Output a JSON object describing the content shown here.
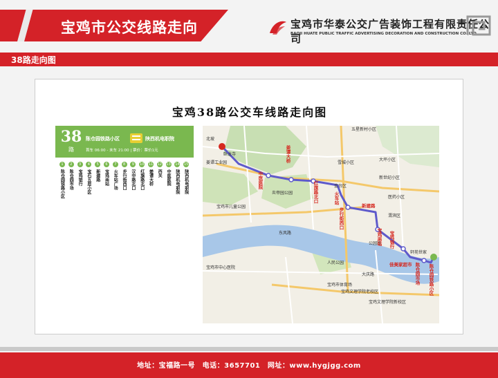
{
  "header": {
    "title": "宝鸡市公交线路走向",
    "company_cn": "宝鸡市华泰公交广告装饰工程有限责任公司",
    "company_en": "BAOJI HUATE PUBLIC TRAFFIC ADVERTISING DECORATION AND CONSTRUCTION CO.,LTD"
  },
  "section": {
    "title": "38路走向图"
  },
  "card": {
    "title": "宝鸡38路公交车线路走向图"
  },
  "route": {
    "number": "38",
    "unit": "路",
    "from": "陈仓园铁路小区",
    "to": "陕西机电职院",
    "hours": "首车 06:00 - 末车 21:00",
    "fare": "票价：票价1元",
    "stops": [
      {
        "no": "1",
        "name": "陈仓园铁路小区"
      },
      {
        "no": "2",
        "name": "陈仓园市场"
      },
      {
        "no": "3",
        "name": "宝鸡银行"
      },
      {
        "no": "4",
        "name": "宝石五层小区"
      },
      {
        "no": "5",
        "name": "新建路"
      },
      {
        "no": "6",
        "name": "宝鸡南站"
      },
      {
        "no": "7",
        "name": "火车站广场"
      },
      {
        "no": "8",
        "name": "步行街西口"
      },
      {
        "no": "9",
        "name": "汉中路北口"
      },
      {
        "no": "10",
        "name": "红旗路北口"
      },
      {
        "no": "11",
        "name": "姜谭大桥"
      },
      {
        "no": "12",
        "name": "西关"
      },
      {
        "no": "13",
        "name": "中医医院"
      },
      {
        "no": "14",
        "name": "陕西机电职院"
      },
      {
        "no": "15",
        "name": "陕西机电职院"
      }
    ]
  },
  "map": {
    "labels": [
      "五星新村小区",
      "卧龙寺",
      "北坡",
      "姜谭工业园",
      "雪城小区",
      "金台区",
      "大坪小区",
      "新世纪小区",
      "医药小区",
      "渭滨区",
      "宝鸡市儿童公园",
      "炎帝园公园",
      "人民公园",
      "宝鸡市体育场",
      "宝鸡文理学院老校区",
      "宝鸡市中心医院",
      "东风路",
      "轩苑世家",
      "公园路",
      "宝鸡文理学院新校区",
      "大庆路"
    ],
    "route_labels": [
      "姜谭大桥",
      "中医医院",
      "红旗路北口",
      "火车站",
      "步行街西口",
      "新建路",
      "宝鸡银行",
      "佳美家超市",
      "陈仓园市场",
      "陈仓园铁路小区",
      "宝鸡南站"
    ]
  },
  "footer": {
    "text": "地址：宝福路一号　电话：3657701　网址：www.hygjgg.com"
  },
  "colors": {
    "brand_red": "#d42228",
    "route_green": "#7ab84f",
    "route_line": "#5e5acb"
  }
}
